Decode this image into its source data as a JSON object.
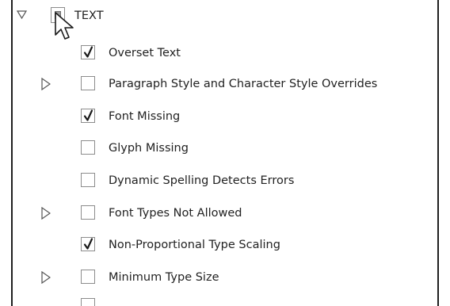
{
  "group": {
    "label": "TEXT",
    "expanded": true,
    "state": "mixed"
  },
  "items": [
    {
      "label": "Overset Text",
      "checked": true,
      "expandable": false
    },
    {
      "label": "Paragraph Style and Character Style Overrides",
      "checked": false,
      "expandable": true
    },
    {
      "label": "Font Missing",
      "checked": true,
      "expandable": false
    },
    {
      "label": "Glyph Missing",
      "checked": false,
      "expandable": false
    },
    {
      "label": "Dynamic Spelling Detects Errors",
      "checked": false,
      "expandable": false
    },
    {
      "label": "Font Types Not Allowed",
      "checked": false,
      "expandable": true
    },
    {
      "label": "Non-Proportional Type Scaling",
      "checked": true,
      "expandable": false
    },
    {
      "label": "Minimum Type Size",
      "checked": false,
      "expandable": true
    }
  ],
  "icons": {
    "expand_open": "triangle-down-icon",
    "expand_closed": "triangle-right-icon",
    "check": "checkmark-icon",
    "pointer": "mouse-pointer-icon"
  },
  "colors": {
    "border": "#1f1f1f",
    "checkbox_border": "#8c8c8c",
    "text": "#222222"
  }
}
